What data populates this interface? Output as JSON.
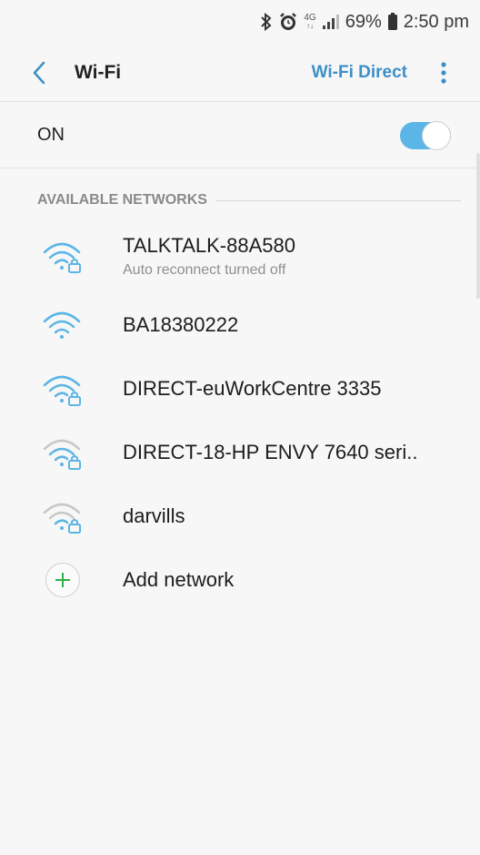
{
  "status_bar": {
    "network_type": "4G",
    "network_sub": "↑↓",
    "battery": "69%",
    "time": "2:50 pm",
    "icons": [
      "bluetooth-icon",
      "alarm-icon",
      "signal-icon",
      "battery-icon"
    ]
  },
  "header": {
    "title": "Wi-Fi",
    "wifi_direct_label": "Wi-Fi Direct"
  },
  "wifi_toggle": {
    "label": "ON",
    "state": true,
    "accent_color": "#5bb5e6"
  },
  "available_networks": {
    "section_title": "AVAILABLE NETWORKS",
    "items": [
      {
        "name": "TALKTALK-88A580",
        "sub": "Auto reconnect turned off",
        "secured": true,
        "signal": "strong"
      },
      {
        "name": "BA18380222",
        "sub": "",
        "secured": false,
        "signal": "strong"
      },
      {
        "name": "DIRECT-euWorkCentre 3335",
        "sub": "",
        "secured": true,
        "signal": "strong"
      },
      {
        "name": "DIRECT-18-HP ENVY 7640 seri..",
        "sub": "",
        "secured": true,
        "signal": "weak"
      },
      {
        "name": "darvills",
        "sub": "",
        "secured": true,
        "signal": "weak"
      }
    ],
    "add_label": "Add network"
  },
  "colors": {
    "accent": "#3d8fc7",
    "wifi_strong": "#5bb5e6",
    "wifi_weak": "#c8c8c8",
    "add_plus": "#2fb14a"
  }
}
